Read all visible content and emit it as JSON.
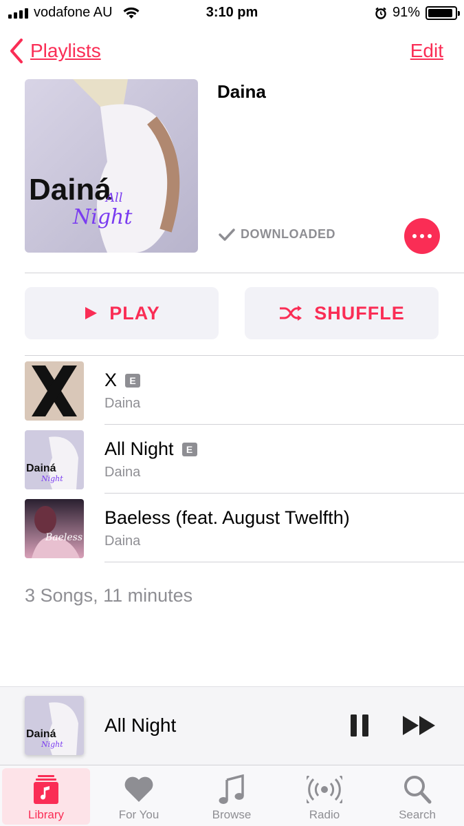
{
  "status_bar": {
    "carrier": "vodafone AU",
    "time": "3:10 pm",
    "battery": "91%",
    "battery_level": 0.91
  },
  "nav": {
    "back_label": "Playlists",
    "edit_label": "Edit"
  },
  "playlist": {
    "title": "Daina",
    "downloaded_label": "DOWNLOADED",
    "album_art_text": "Dainá",
    "album_art_subtext": "All Night"
  },
  "actions": {
    "play_label": "PLAY",
    "shuffle_label": "SHUFFLE"
  },
  "tracks": [
    {
      "title": "X",
      "artist": "Daina",
      "explicit": "E"
    },
    {
      "title": "All Night",
      "artist": "Daina",
      "explicit": "E"
    },
    {
      "title": "Baeless (feat. August Twelfth)",
      "artist": "Daina",
      "explicit": ""
    }
  ],
  "summary": "3 Songs, 11 minutes",
  "now_playing": {
    "title": "All Night"
  },
  "tabs": [
    {
      "label": "Library",
      "icon": "library-icon",
      "active": true
    },
    {
      "label": "For You",
      "icon": "heart-icon",
      "active": false
    },
    {
      "label": "Browse",
      "icon": "music-note-icon",
      "active": false
    },
    {
      "label": "Radio",
      "icon": "radio-icon",
      "active": false
    },
    {
      "label": "Search",
      "icon": "search-icon",
      "active": false
    }
  ],
  "colors": {
    "accent": "#fa2d55",
    "secondary_text": "#8e8e93",
    "button_bg": "#f2f2f7"
  }
}
